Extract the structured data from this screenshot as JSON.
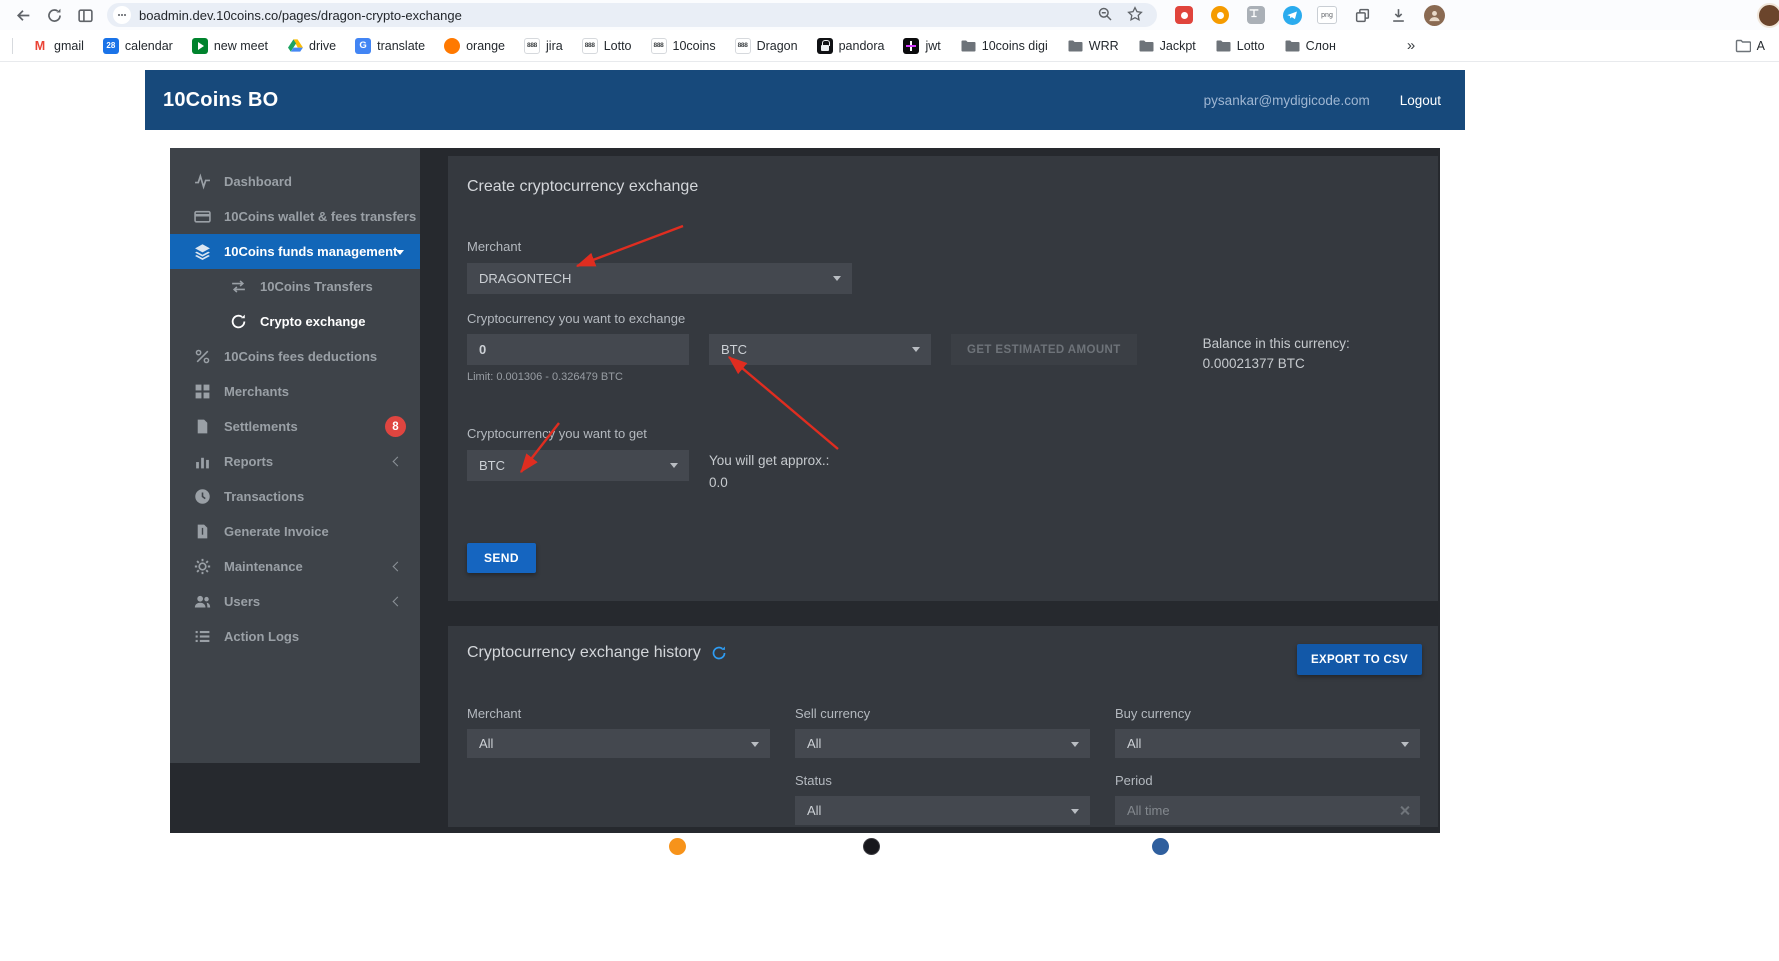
{
  "browser": {
    "url": "boadmin.dev.10coins.co/pages/dragon-crypto-exchange",
    "calendar_day": "28",
    "favicon_text": "888",
    "png_badge": "png",
    "overflow_label": "»",
    "bookmarks": [
      {
        "label": "gmail",
        "icon": "gmail-icon"
      },
      {
        "label": "calendar",
        "icon": "calendar-icon"
      },
      {
        "label": "new meet",
        "icon": "meet-icon"
      },
      {
        "label": "drive",
        "icon": "drive-icon"
      },
      {
        "label": "translate",
        "icon": "translate-icon"
      },
      {
        "label": "orange",
        "icon": "orange-icon"
      },
      {
        "label": "jira",
        "icon": "favicon-888-icon"
      },
      {
        "label": "Lotto",
        "icon": "favicon-888-icon"
      },
      {
        "label": "10coins",
        "icon": "favicon-888-icon"
      },
      {
        "label": "Dragon",
        "icon": "favicon-888-icon"
      },
      {
        "label": "pandora",
        "icon": "lock-icon"
      },
      {
        "label": "jwt",
        "icon": "jwt-icon"
      },
      {
        "label": "10coins digi",
        "icon": "folder-icon"
      },
      {
        "label": "WRR",
        "icon": "folder-icon"
      },
      {
        "label": "Jackpt",
        "icon": "folder-icon"
      },
      {
        "label": "Lotto",
        "icon": "folder-icon"
      },
      {
        "label": "Слон",
        "icon": "folder-icon"
      },
      {
        "label": "A",
        "icon": "folder-icon"
      }
    ]
  },
  "header": {
    "title": "10Coins BO",
    "user_email": "pysankar@mydigicode.com",
    "logout_label": "Logout"
  },
  "sidebar": {
    "items": [
      {
        "label": "Dashboard",
        "icon": "pulse-icon"
      },
      {
        "label": "10Coins wallet & fees transfers",
        "icon": "card-icon"
      },
      {
        "label": "10Coins funds management",
        "icon": "layers-icon",
        "state": "active-expanded"
      },
      {
        "label": "10Coins Transfers",
        "icon": "swap-icon",
        "level": 2
      },
      {
        "label": "Crypto exchange",
        "icon": "sync-icon",
        "level": 2,
        "state": "selected"
      },
      {
        "label": "10Coins fees deductions",
        "icon": "percent-icon"
      },
      {
        "label": "Merchants",
        "icon": "grid-icon"
      },
      {
        "label": "Settlements",
        "icon": "document-icon",
        "badge": "8"
      },
      {
        "label": "Reports",
        "icon": "bar-chart-icon",
        "collapsible": true
      },
      {
        "label": "Transactions",
        "icon": "clock-icon"
      },
      {
        "label": "Generate Invoice",
        "icon": "invoice-icon"
      },
      {
        "label": "Maintenance",
        "icon": "gear-icon",
        "collapsible": true
      },
      {
        "label": "Users",
        "icon": "users-icon",
        "collapsible": true
      },
      {
        "label": "Action Logs",
        "icon": "list-icon"
      }
    ]
  },
  "exchange_form": {
    "title": "Create cryptocurrency exchange",
    "merchant_label": "Merchant",
    "merchant_value": "DRAGONTECH",
    "sell_label": "Cryptocurrency you want to exchange",
    "amount_value": "0",
    "limit_text": "Limit: 0.001306 - 0.326479 BTC",
    "sell_currency_value": "BTC",
    "estimate_button_label": "GET ESTIMATED AMOUNT",
    "balance_label": "Balance in this currency:",
    "balance_value": "0.00021377 BTC",
    "buy_label": "Cryptocurrency you want to get",
    "buy_currency_value": "BTC",
    "approx_label": "You will get approx.:",
    "approx_value": "0.0",
    "send_button_label": "SEND"
  },
  "history": {
    "title": "Cryptocurrency exchange history",
    "export_button_label": "EXPORT TO CSV",
    "merchant_filter_label": "Merchant",
    "merchant_filter_value": "All",
    "sell_filter_label": "Sell currency",
    "sell_filter_value": "All",
    "buy_filter_label": "Buy currency",
    "buy_filter_value": "All",
    "status_filter_label": "Status",
    "status_filter_value": "All",
    "period_filter_label": "Period",
    "period_filter_value": "All time"
  },
  "colors": {
    "header_blue": "#17497b",
    "accent_blue": "#1565c0",
    "badge_red": "#df4540",
    "annotation_red": "#e02d20"
  }
}
